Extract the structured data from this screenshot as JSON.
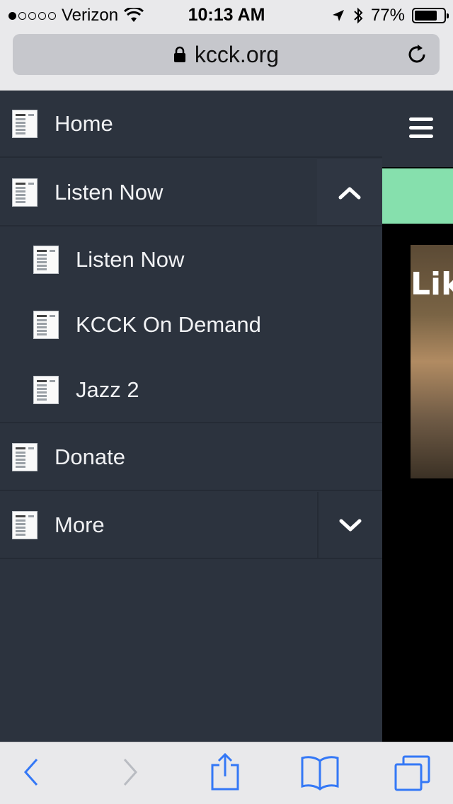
{
  "status_bar": {
    "carrier": "Verizon",
    "time": "10:13 AM",
    "battery": "77%",
    "battery_level": 0.77,
    "signal_filled_dots": 1,
    "signal_total_dots": 5
  },
  "browser": {
    "url": "kcck.org"
  },
  "menu": {
    "items": [
      {
        "label": "Home"
      },
      {
        "label": "Listen Now",
        "expanded": true,
        "children": [
          {
            "label": "Listen Now"
          },
          {
            "label": "KCCK On Demand"
          },
          {
            "label": "Jazz 2"
          }
        ]
      },
      {
        "label": "Donate"
      },
      {
        "label": "More",
        "expanded": false
      }
    ]
  },
  "page": {
    "photo_text": "Like",
    "accent_color": "#86e0ad",
    "menu_bg_color": "#2c333e"
  },
  "toolbar": {
    "tint_color": "#3478f6"
  }
}
